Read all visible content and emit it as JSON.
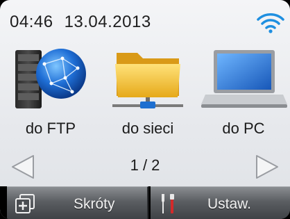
{
  "status": {
    "time": "04:46",
    "date": "13.04.2013",
    "wifi_icon": "wifi-icon"
  },
  "tiles": [
    {
      "label": "do FTP",
      "icon": "ftp-server-globe-icon"
    },
    {
      "label": "do sieci",
      "icon": "network-folder-icon"
    },
    {
      "label": "do PC",
      "icon": "laptop-icon"
    }
  ],
  "pager": {
    "indicator": "1 / 2"
  },
  "bottom_bar": {
    "shortcuts_label": "Skróty",
    "settings_label": "Ustaw."
  },
  "colors": {
    "wifi": "#1e8fe0",
    "accent_blue": "#1e6fd0",
    "folder": "#f2c43a"
  }
}
